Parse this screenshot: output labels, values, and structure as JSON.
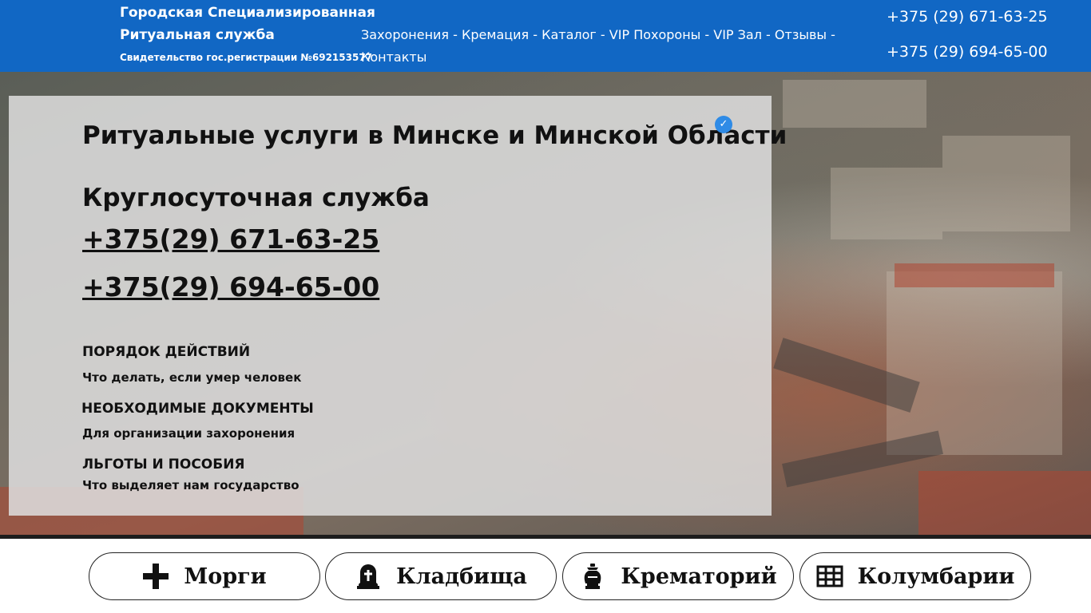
{
  "header": {
    "brand_line1": "Городская Специализированная",
    "brand_line2": "Ритуальная служба",
    "certificate": "Свидетельство гос.регистрации №692153577",
    "nav": [
      {
        "label": "Захоронения"
      },
      {
        "label": "Кремация"
      },
      {
        "label": "Каталог"
      },
      {
        "label": "VIP Похороны"
      },
      {
        "label": "VIP Зал"
      },
      {
        "label": "Отзывы"
      },
      {
        "label": "Контакты"
      }
    ],
    "separator": " - ",
    "phone1": "+375 (29) 671-63-25",
    "phone2": "+375 (29) 694-65-00"
  },
  "hero": {
    "title": "Ритуальные услуги в Минске и Минской Области",
    "verified_icon": "verified-badge-icon",
    "subtitle": "Круглосуточная служба",
    "phone1": "+375(29) 671-63-25",
    "phone2": "+375(29) 694-65-00",
    "sections": [
      {
        "heading": "ПОРЯДОК ДЕЙСТВИЙ",
        "sub": "Что делать, если умер человек"
      },
      {
        "heading": "НЕОБХОДИМЫЕ ДОКУМЕНТЫ",
        "sub": "Для организации захоронения"
      },
      {
        "heading": "ЛЬГОТЫ И ПОСОБИЯ",
        "sub": "Что выделяет нам государство"
      }
    ]
  },
  "categories": [
    {
      "label": "Морги",
      "icon": "cross-icon"
    },
    {
      "label": "Кладбища",
      "icon": "gravestone-icon"
    },
    {
      "label": "Крематорий",
      "icon": "urn-icon"
    },
    {
      "label": "Колумбарии",
      "icon": "columbarium-grid-icon"
    }
  ],
  "colors": {
    "header_bg": "#1167c4",
    "verified": "#2f8be6",
    "panel_bg": "#dedede",
    "text": "#111111"
  }
}
